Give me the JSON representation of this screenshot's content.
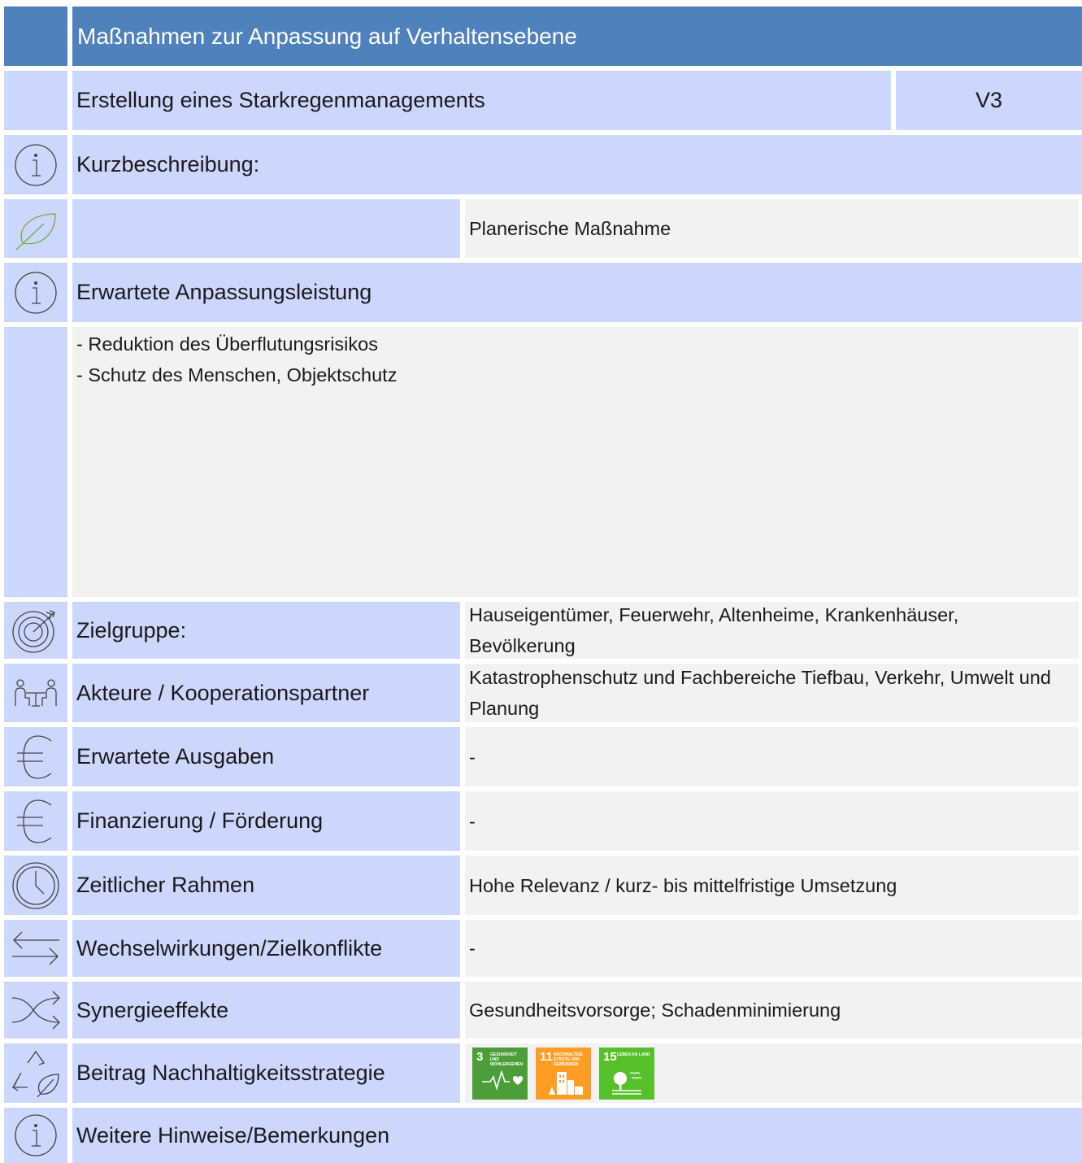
{
  "header": {
    "title": "Maßnahmen zur Anpassung auf Verhaltensebene"
  },
  "measure": {
    "title": "Erstellung eines Starkregenmanagements",
    "code": "V3"
  },
  "short_description": {
    "label": "Kurzbeschreibung:"
  },
  "category": {
    "value": "Planerische Maßnahme"
  },
  "expected_performance": {
    "label": "Erwartete Anpassungsleistung",
    "items": [
      "- Reduktion des Überflutungsrisikos",
      "- Schutz des Menschen, Objektschutz"
    ]
  },
  "target_group": {
    "label": "Zielgruppe:",
    "value": "Hauseigentümer, Feuerwehr, Altenheime, Krankenhäuser, Bevölkerung"
  },
  "actors": {
    "label": "Akteure / Kooperationspartner",
    "value": "Katastrophenschutz und Fachbereiche Tiefbau, Verkehr, Umwelt und Planung"
  },
  "expected_costs": {
    "label": "Erwartete Ausgaben",
    "value": "-"
  },
  "financing": {
    "label": "Finanzierung / Förderung",
    "value": "-"
  },
  "timeframe": {
    "label": "Zeitlicher Rahmen",
    "value": "Hohe Relevanz / kurz- bis mittelfristige Umsetzung"
  },
  "interactions": {
    "label": "Wechselwirkungen/Zielkonflikte",
    "value": "-"
  },
  "synergies": {
    "label": "Synergieeffekte",
    "value": "Gesundheitsvorsorge; Schadenminimierung"
  },
  "sustainability": {
    "label": "Beitrag Nachhaltigkeitsstrategie",
    "goals": [
      {
        "number": "3",
        "text": "Gesundheit und Wohlergehen",
        "color": "#4c9f38",
        "icon": "heartbeat-icon"
      },
      {
        "number": "11",
        "text": "Nachhaltige Städte und Gemeinden",
        "color": "#fd9d24",
        "icon": "city-icon"
      },
      {
        "number": "15",
        "text": "Leben an Land",
        "color": "#56c02b",
        "icon": "tree-bird-icon"
      }
    ]
  },
  "remarks": {
    "label": "Weitere Hinweise/Bemerkungen"
  },
  "colors": {
    "header": "#4f81bd",
    "label_bg": "#ccd7fe",
    "value_bg": "#f2f2f2"
  }
}
